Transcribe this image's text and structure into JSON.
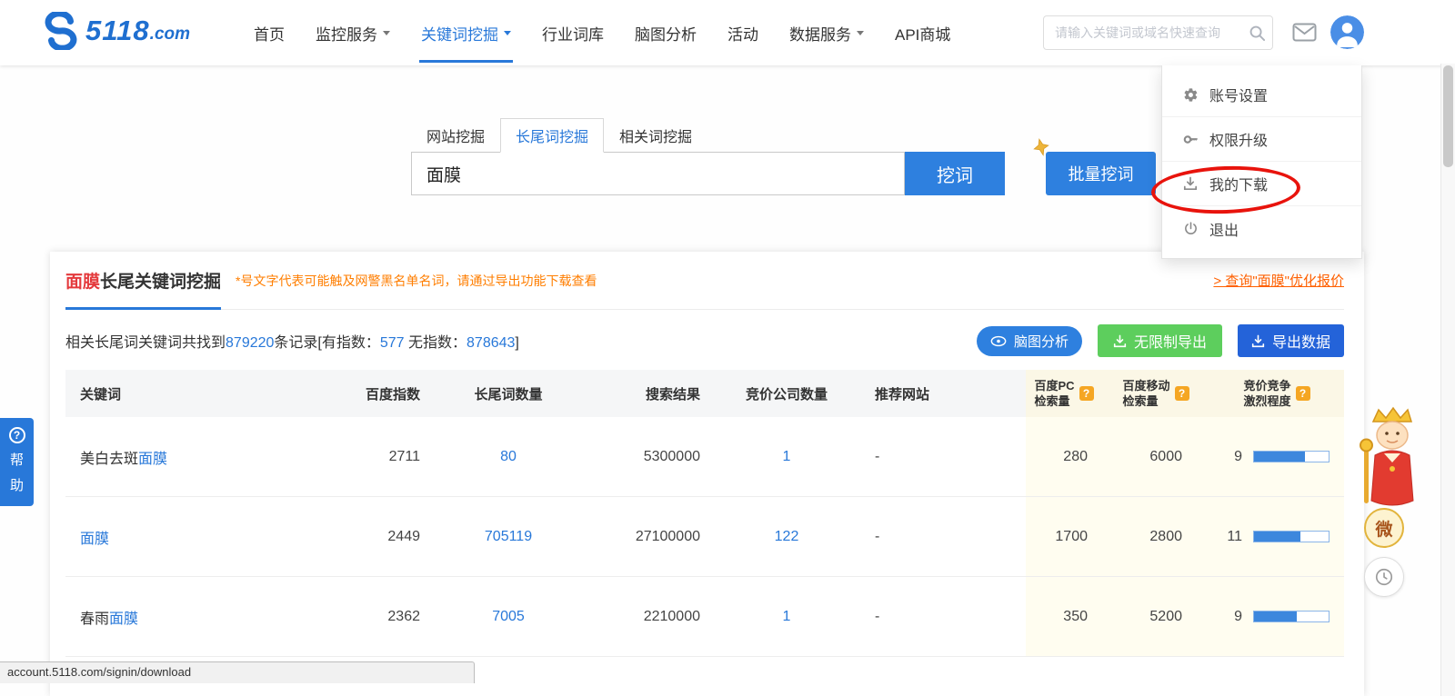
{
  "colors": {
    "primary_blue": "#2e80df",
    "link_blue": "#2878d9",
    "export_blue": "#2463d9",
    "green": "#5dce5d",
    "orange_warning": "#ff7e00",
    "orange_link": "#ff6000",
    "title_red": "#e4393c",
    "annotation_red": "#e8130c",
    "highlight_column_bg": "#fffdf0"
  },
  "icons": {
    "logo-icon": "blue S swirl",
    "chevron-down-icon": "css triangle down",
    "search-icon": "magnifier",
    "mail-icon": "envelope outline",
    "user-avatar": "white person on blue circle",
    "gear-icon": "settings gear",
    "key-icon": "key",
    "download-icon": "arrow into tray",
    "power-icon": "power symbol",
    "gold-decoration-icon": "gold star",
    "mindmap-icon": "ellipse node",
    "help-badge-icon": "orange ? square",
    "question-icon": "? in circle",
    "clock-icon": "clock face",
    "mascot-image": "cartoon king with crown"
  },
  "topnav": {
    "logo_number": "5118",
    "logo_suffix": ".com",
    "items": [
      {
        "label": "首页",
        "active": false,
        "has_dropdown": false
      },
      {
        "label": "监控服务",
        "active": false,
        "has_dropdown": true
      },
      {
        "label": "关键词挖掘",
        "active": true,
        "has_dropdown": true
      },
      {
        "label": "行业词库",
        "active": false,
        "has_dropdown": false
      },
      {
        "label": "脑图分析",
        "active": false,
        "has_dropdown": false
      },
      {
        "label": "活动",
        "active": false,
        "has_dropdown": false
      },
      {
        "label": "数据服务",
        "active": false,
        "has_dropdown": true
      },
      {
        "label": "API商城",
        "active": false,
        "has_dropdown": false
      }
    ],
    "search_placeholder": "请输入关键词或域名快速查询"
  },
  "user_menu": {
    "items": [
      {
        "label": "账号设置",
        "icon": "gear-icon"
      },
      {
        "label": "权限升级",
        "icon": "key-icon"
      },
      {
        "label": "我的下载",
        "icon": "download-icon",
        "annotated_with_red_circle": true
      },
      {
        "label": "退出",
        "icon": "power-icon"
      }
    ]
  },
  "mining": {
    "tabs": [
      {
        "label": "网站挖掘",
        "active": false
      },
      {
        "label": "长尾词挖掘",
        "active": true
      },
      {
        "label": "相关词挖掘",
        "active": false
      }
    ],
    "keyword_value": "面膜",
    "mine_button": "挖词",
    "batch_button": "批量挖词"
  },
  "panel": {
    "title_keyword": "面膜",
    "title_rest": "长尾关键词挖掘",
    "warning": "*号文字代表可能触及网警黑名单名词，请通过导出功能下载查看",
    "quote_link": "> 查询\"面膜\"优化报价",
    "stats": {
      "prefix": "相关长尾词关键词共找到",
      "total": "879220",
      "mid1": "条记录[有指数：",
      "indexed": "577",
      "mid2": " 无指数：",
      "unindexed": "878643",
      "suffix": "]"
    },
    "buttons": {
      "mindmap": "脑图分析",
      "unlimited_export": "无限制导出",
      "export_data": "导出数据"
    }
  },
  "table": {
    "headers": {
      "keyword": "关键词",
      "baidu_index": "百度指数",
      "longtail_count": "长尾词数量",
      "search_results": "搜索结果",
      "bidding_companies": "竞价公司数量",
      "recommended_site": "推荐网站",
      "pc_volume_line1": "百度PC",
      "pc_volume_line2": "检索量",
      "mobile_volume_line1": "百度移动",
      "mobile_volume_line2": "检索量",
      "competition_line1": "竞价竞争",
      "competition_line2": "激烈程度",
      "badge": "?"
    },
    "rows": [
      {
        "keyword_prefix": "美白去斑",
        "keyword_highlight": "面膜",
        "baidu_index": "2711",
        "longtail_count": "80",
        "search_results": "5300000",
        "bidding_companies": "1",
        "recommended_site": "-",
        "pc_volume": "280",
        "mobile_volume": "6000",
        "competition": "9",
        "competition_bar_percent": 68
      },
      {
        "keyword_prefix": "",
        "keyword_highlight": "面膜",
        "baidu_index": "2449",
        "longtail_count": "705119",
        "search_results": "27100000",
        "bidding_companies": "122",
        "recommended_site": "-",
        "pc_volume": "1700",
        "mobile_volume": "2800",
        "competition": "11",
        "competition_bar_percent": 62
      },
      {
        "keyword_prefix": "春雨",
        "keyword_highlight": "面膜",
        "baidu_index": "2362",
        "longtail_count": "7005",
        "search_results": "2210000",
        "bidding_companies": "1",
        "recommended_site": "-",
        "pc_volume": "350",
        "mobile_volume": "5200",
        "competition": "9",
        "competition_bar_percent": 57
      }
    ]
  },
  "help_widget": {
    "question_mark": "?",
    "char1": "帮",
    "char2": "助"
  },
  "floaters": {
    "wechat_label": "微"
  },
  "statusbar": {
    "text": "account.5118.com/signin/download"
  }
}
